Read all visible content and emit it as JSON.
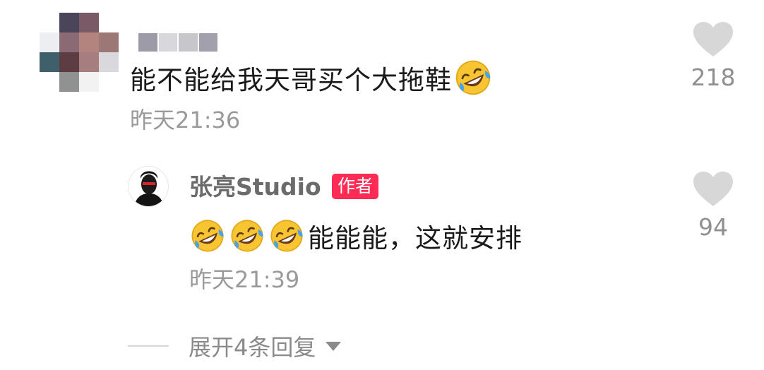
{
  "comment": {
    "text": "能不能给我天哥买个大拖鞋",
    "time": "昨天21:36",
    "likes": "218"
  },
  "reply": {
    "author": "张亮Studio",
    "badge": "作者",
    "text": "能能能，这就安排",
    "time": "昨天21:39",
    "likes": "94"
  },
  "expand": {
    "label": "展开4条回复"
  },
  "colors": {
    "badge": "#fe2c55",
    "heart": "#d7d7d7",
    "muted_text": "#9a9a9a"
  },
  "icons": {
    "like": "heart-icon",
    "emoji": "rofl-emoji-icon",
    "expand": "caret-down-icon"
  }
}
